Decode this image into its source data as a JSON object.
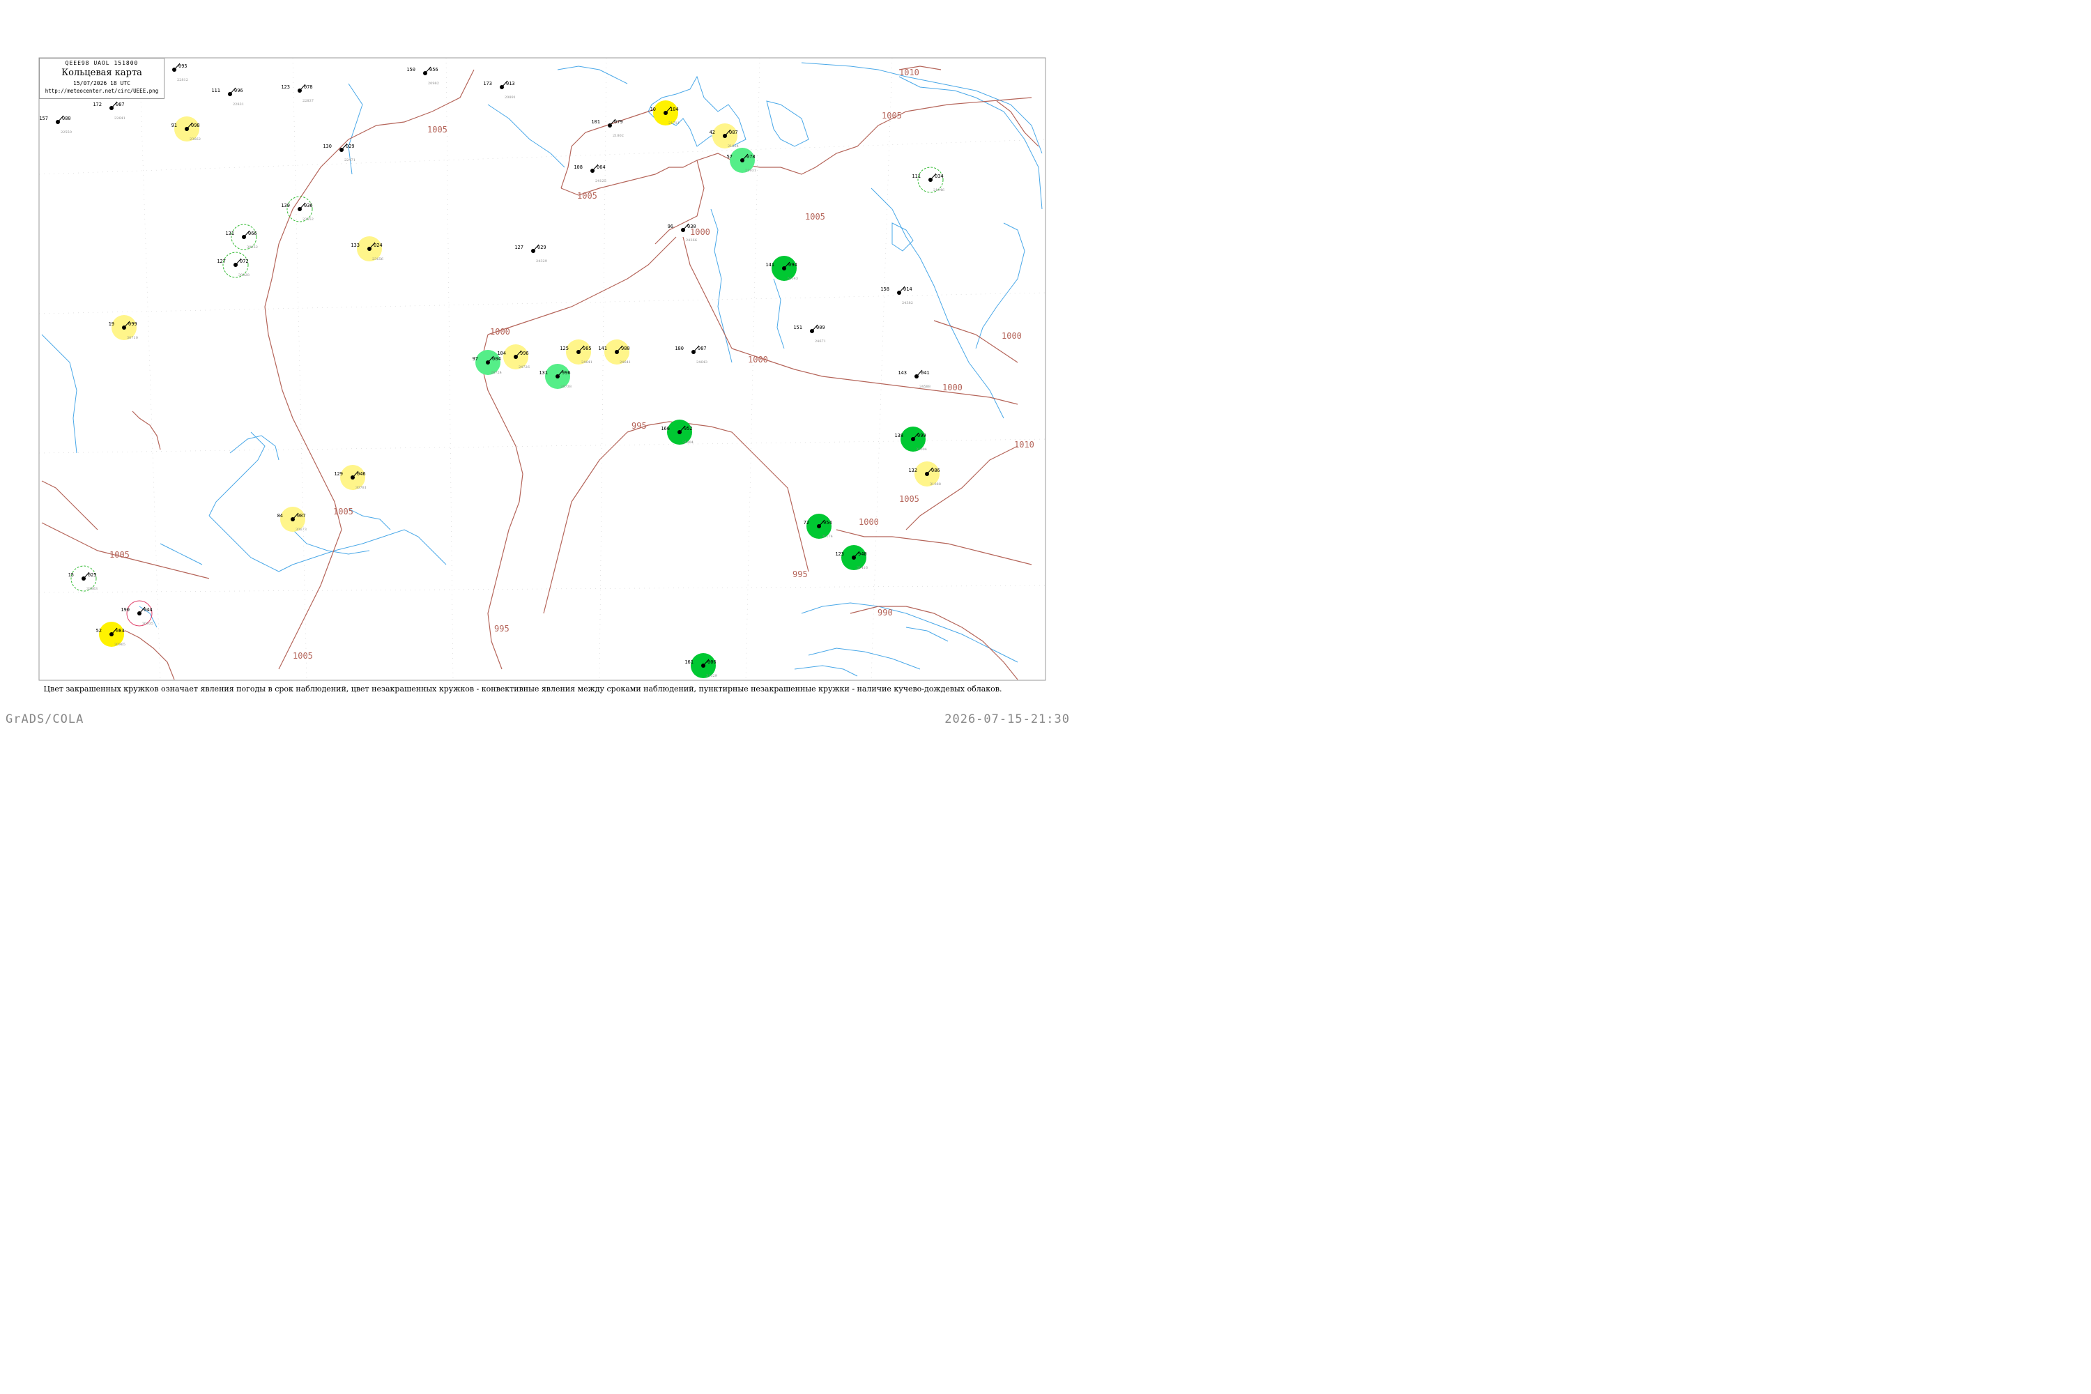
{
  "header": {
    "code_line": "QEEE98  UAOL  151800",
    "title": "Кольцевая карта",
    "date": "15/07/2026 18 UTC",
    "url": "http://meteocenter.net/circ/UEEE.png"
  },
  "caption": "Цвет закрашенных кружков означает явления погоды в срок наблюдений, цвет незакрашенных кружков - конвективные явления между сроками наблюдений, пунктирные незакрашенные кружки - наличие кучево-дождевых облаков.",
  "footer": {
    "left": "GrADS/COLA",
    "right": "2026-07-15-21:30"
  },
  "colors": {
    "isobar": "#b5655a",
    "water": "#4aa8e8",
    "station_text": "#000000",
    "station_id_text": "#888888",
    "yellow_fill": "#fff200",
    "light_yellow_fill": "#fff58a",
    "green_fill": "#00c832",
    "light_green_fill": "#55ee88",
    "dashed_ring": "#33bb33",
    "red_ring": "#e0406a"
  },
  "isobar_labels": [
    "1010",
    "1005",
    "1005",
    "1005",
    "1005",
    "1005",
    "1005",
    "1005",
    "1000",
    "1000",
    "1000",
    "1000",
    "1000",
    "995",
    "995",
    "995",
    "990",
    "1010",
    "1000",
    "1005"
  ],
  "stations": [
    {
      "id": "22812",
      "p": "095",
      "t": "10"
    },
    {
      "id": "22831",
      "p": "096",
      "t": "111"
    },
    {
      "id": "22837",
      "p": "078",
      "t": "123"
    },
    {
      "id": "22471",
      "p": "029",
      "t": "130"
    },
    {
      "id": "20982",
      "p": "056",
      "t": "150"
    },
    {
      "id": "20891",
      "p": "013",
      "t": "173"
    },
    {
      "id": "21711",
      "p": "104",
      "t": "10"
    },
    {
      "id": "21802",
      "p": "079",
      "t": "101"
    },
    {
      "id": "21824",
      "p": "087",
      "t": "42"
    },
    {
      "id": "21931",
      "p": "078",
      "t": "57"
    },
    {
      "id": "21946",
      "p": "034",
      "t": "111"
    },
    {
      "id": "24125",
      "p": "064",
      "t": "108"
    },
    {
      "id": "23662",
      "p": "098",
      "t": "91"
    },
    {
      "id": "22550",
      "p": "080",
      "t": "157"
    },
    {
      "id": "22641",
      "p": "087",
      "t": "172"
    },
    {
      "id": "23552",
      "p": "036",
      "t": "139"
    },
    {
      "id": "23656",
      "p": "024",
      "t": "133"
    },
    {
      "id": "24329",
      "p": "029",
      "t": "127"
    },
    {
      "id": "24266",
      "p": "030",
      "t": "96"
    },
    {
      "id": "24382",
      "p": "014",
      "t": "158"
    },
    {
      "id": "24143",
      "p": "094",
      "t": "141"
    },
    {
      "id": "24641",
      "p": "980",
      "t": "141"
    },
    {
      "id": "24738",
      "p": "996",
      "t": "131"
    },
    {
      "id": "24641b",
      "p": "985",
      "t": "125"
    },
    {
      "id": "24726",
      "p": "996",
      "t": "104"
    },
    {
      "id": "24724",
      "p": "004",
      "t": "97"
    },
    {
      "id": "24671",
      "p": "009",
      "t": "151"
    },
    {
      "id": "24643",
      "p": "987",
      "t": "180"
    },
    {
      "id": "24588",
      "p": "041",
      "t": "143"
    },
    {
      "id": "31004",
      "p": "099",
      "t": "138"
    },
    {
      "id": "31088",
      "p": "086",
      "t": "132"
    },
    {
      "id": "30710",
      "p": "099",
      "t": "19"
    },
    {
      "id": "30673",
      "p": "087",
      "t": "84"
    },
    {
      "id": "30935",
      "p": "044",
      "t": "190"
    },
    {
      "id": "30965",
      "p": "083",
      "t": "52"
    },
    {
      "id": "31004b",
      "p": "952",
      "t": "166"
    },
    {
      "id": "31174",
      "p": "954",
      "t": "72"
    },
    {
      "id": "31329",
      "p": "006",
      "t": "161"
    },
    {
      "id": "31416",
      "p": "940",
      "t": "123"
    },
    {
      "id": "30781",
      "p": "046",
      "t": "129"
    },
    {
      "id": "30252",
      "p": "066",
      "t": "131"
    },
    {
      "id": "30328",
      "p": "072",
      "t": "127"
    },
    {
      "id": "32063",
      "p": "025",
      "t": "15"
    }
  ]
}
